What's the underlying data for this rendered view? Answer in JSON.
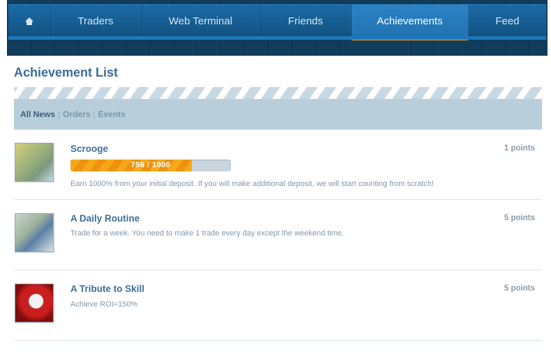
{
  "nav": {
    "home_icon": "home-icon",
    "items": [
      {
        "label": "Traders"
      },
      {
        "label": "Web Terminal"
      },
      {
        "label": "Friends"
      },
      {
        "label": "Achievements"
      },
      {
        "label": "Feed"
      }
    ],
    "active_item": "Achievements",
    "colors": {
      "bar": "#1a6aa5",
      "active": "#2a82c4",
      "active_underline": "#f0a417"
    }
  },
  "page": {
    "title": "Achievement List"
  },
  "filters": {
    "items": [
      {
        "label": "All News"
      },
      {
        "label": "Orders"
      },
      {
        "label": "Events"
      }
    ],
    "separator": "|",
    "active": "All News"
  },
  "achievements": [
    {
      "title": "Scrooge",
      "points": "1 points",
      "progress_label": "756 / 1000",
      "progress_fraction": 0.756,
      "description": "Earn 1000% from your initial deposit. If you will make additional deposit, we will start counting from scratch!"
    },
    {
      "title": "A Daily Routine",
      "points": "5 points",
      "description": "Trade for a week. You need to make 1 trade every day except the weekend time."
    },
    {
      "title": "A Tribute to Skill",
      "points": "5 points",
      "description": "Achieve ROI=150%"
    }
  ]
}
